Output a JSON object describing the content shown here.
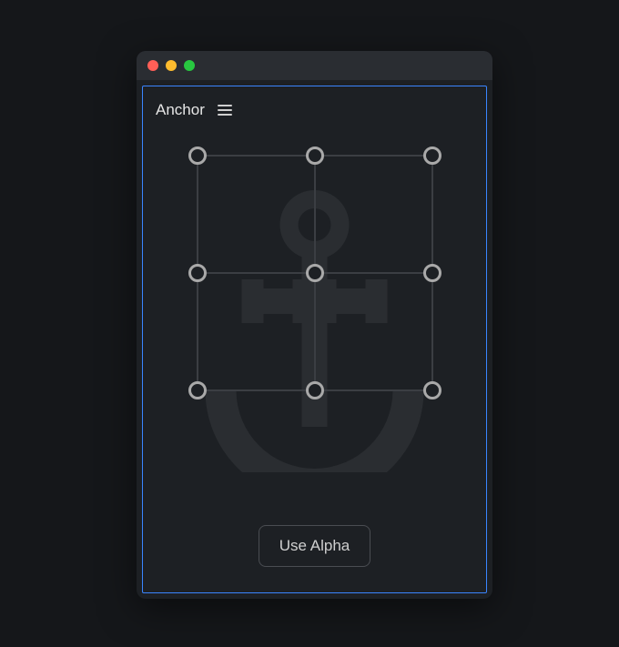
{
  "panel": {
    "title": "Anchor"
  },
  "buttons": {
    "use_alpha": "Use Alpha"
  },
  "colors": {
    "focus_border": "#3a85ff",
    "handle": "#a9a9a9"
  }
}
